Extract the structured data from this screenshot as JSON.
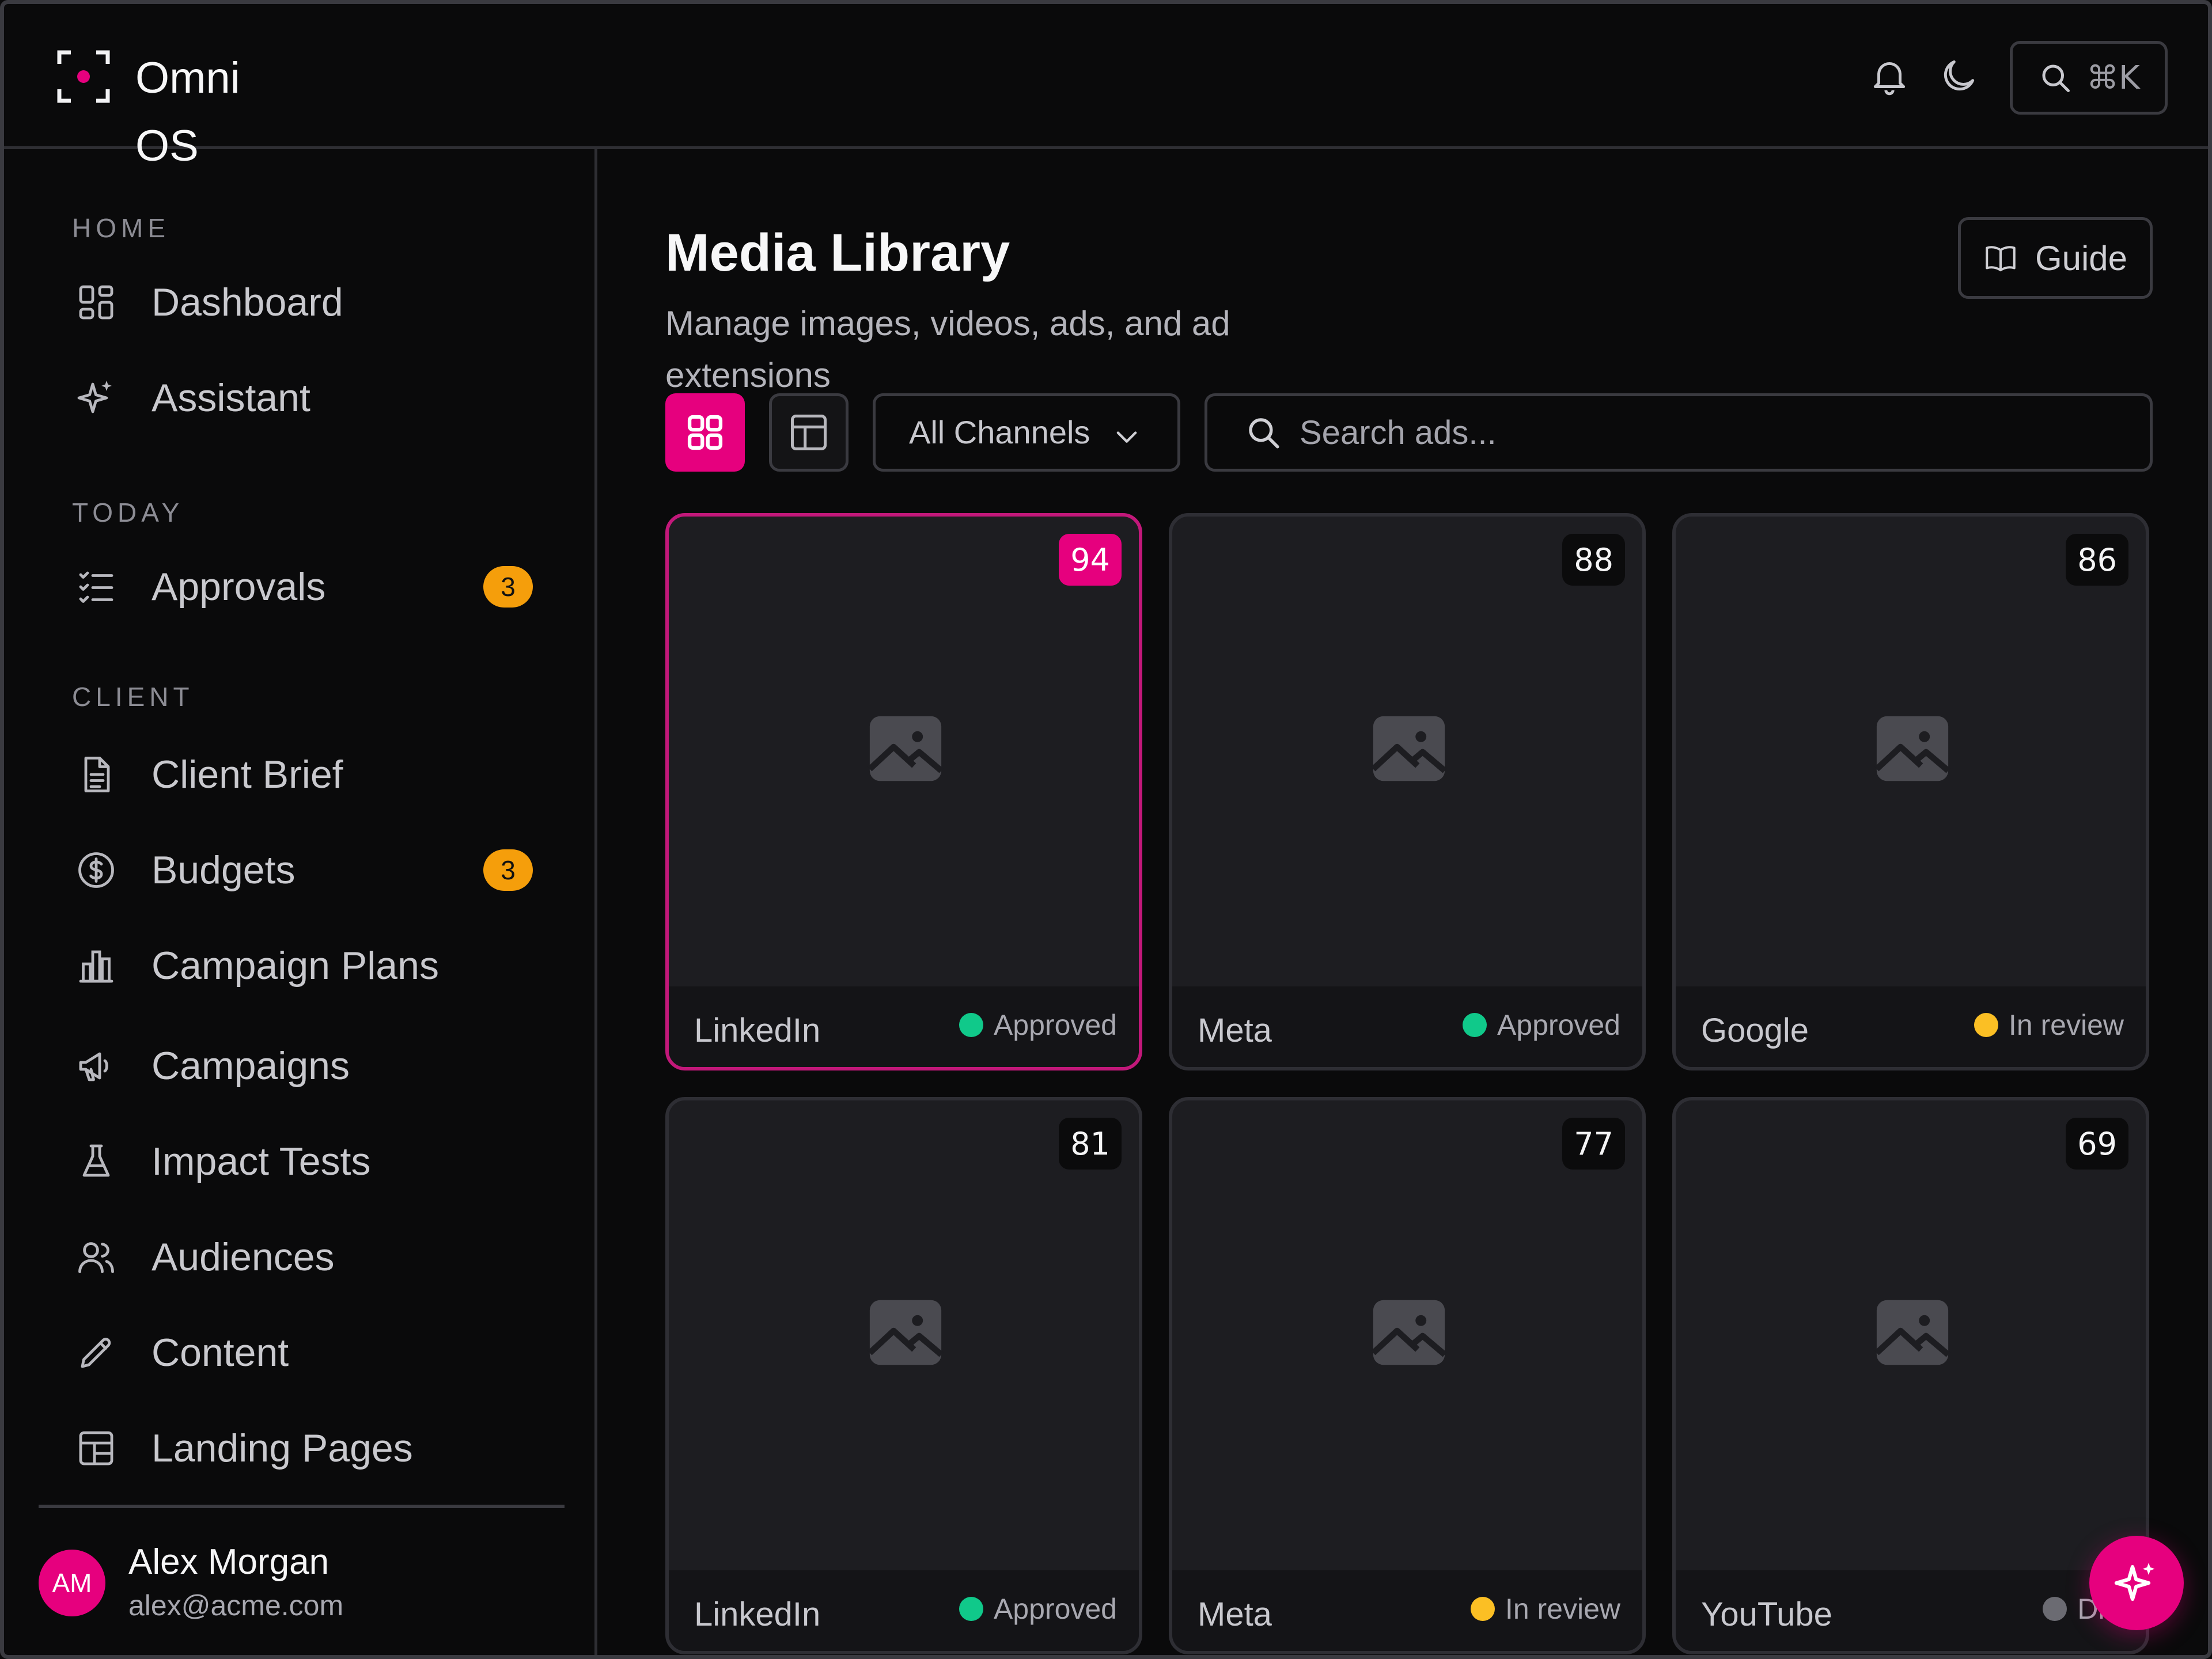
{
  "app": {
    "name": "Omni OS",
    "brand_color": "#e6007e",
    "search_shortcut": "⌘K"
  },
  "header_icons": [
    "bell-icon",
    "moon-icon",
    "search-icon"
  ],
  "sidebar": {
    "sections": [
      {
        "label": "HOME",
        "items": [
          {
            "label": "Dashboard",
            "icon": "dashboard-icon"
          },
          {
            "label": "Assistant",
            "icon": "sparkles-icon"
          }
        ]
      },
      {
        "label": "TODAY",
        "items": [
          {
            "label": "Approvals",
            "icon": "checklist-icon",
            "badge": "3"
          }
        ]
      },
      {
        "label": "CLIENT",
        "items": [
          {
            "label": "Client Brief",
            "icon": "document-icon"
          },
          {
            "label": "Budgets",
            "icon": "dollar-icon",
            "badge": "3"
          },
          {
            "label": "Campaign Plans",
            "icon": "bar-chart-icon"
          },
          {
            "label": "Campaigns",
            "icon": "megaphone-icon"
          },
          {
            "label": "Impact Tests",
            "icon": "flask-icon"
          },
          {
            "label": "Audiences",
            "icon": "users-icon"
          },
          {
            "label": "Content",
            "icon": "pencil-icon"
          },
          {
            "label": "Landing Pages",
            "icon": "layout-icon"
          }
        ]
      }
    ],
    "badge_color": "#f59e0b",
    "user": {
      "initials": "AM",
      "name": "Alex Morgan",
      "email": "alex@acme.com"
    }
  },
  "main": {
    "title": "Media Library",
    "subtitle": "Manage images, videos, ads, and ad extensions",
    "guide_label": "Guide",
    "channel_filter": "All Channels",
    "search_placeholder": "Search ads...",
    "view_mode": "grid",
    "cards": [
      {
        "score": "94",
        "channel": "LinkedIn",
        "status": "Approved",
        "status_color": "#10c98a",
        "selected": true
      },
      {
        "score": "88",
        "channel": "Meta",
        "status": "Approved",
        "status_color": "#10c98a",
        "selected": false
      },
      {
        "score": "86",
        "channel": "Google",
        "status": "In review",
        "status_color": "#fbbf24",
        "selected": false
      },
      {
        "score": "81",
        "channel": "LinkedIn",
        "status": "Approved",
        "status_color": "#10c98a",
        "selected": false
      },
      {
        "score": "77",
        "channel": "Meta",
        "status": "In review",
        "status_color": "#fbbf24",
        "selected": false
      },
      {
        "score": "69",
        "channel": "YouTube",
        "status": "Dra",
        "status_color": "#6b6b72",
        "selected": false
      }
    ]
  },
  "fab_icon": "sparkles-icon"
}
